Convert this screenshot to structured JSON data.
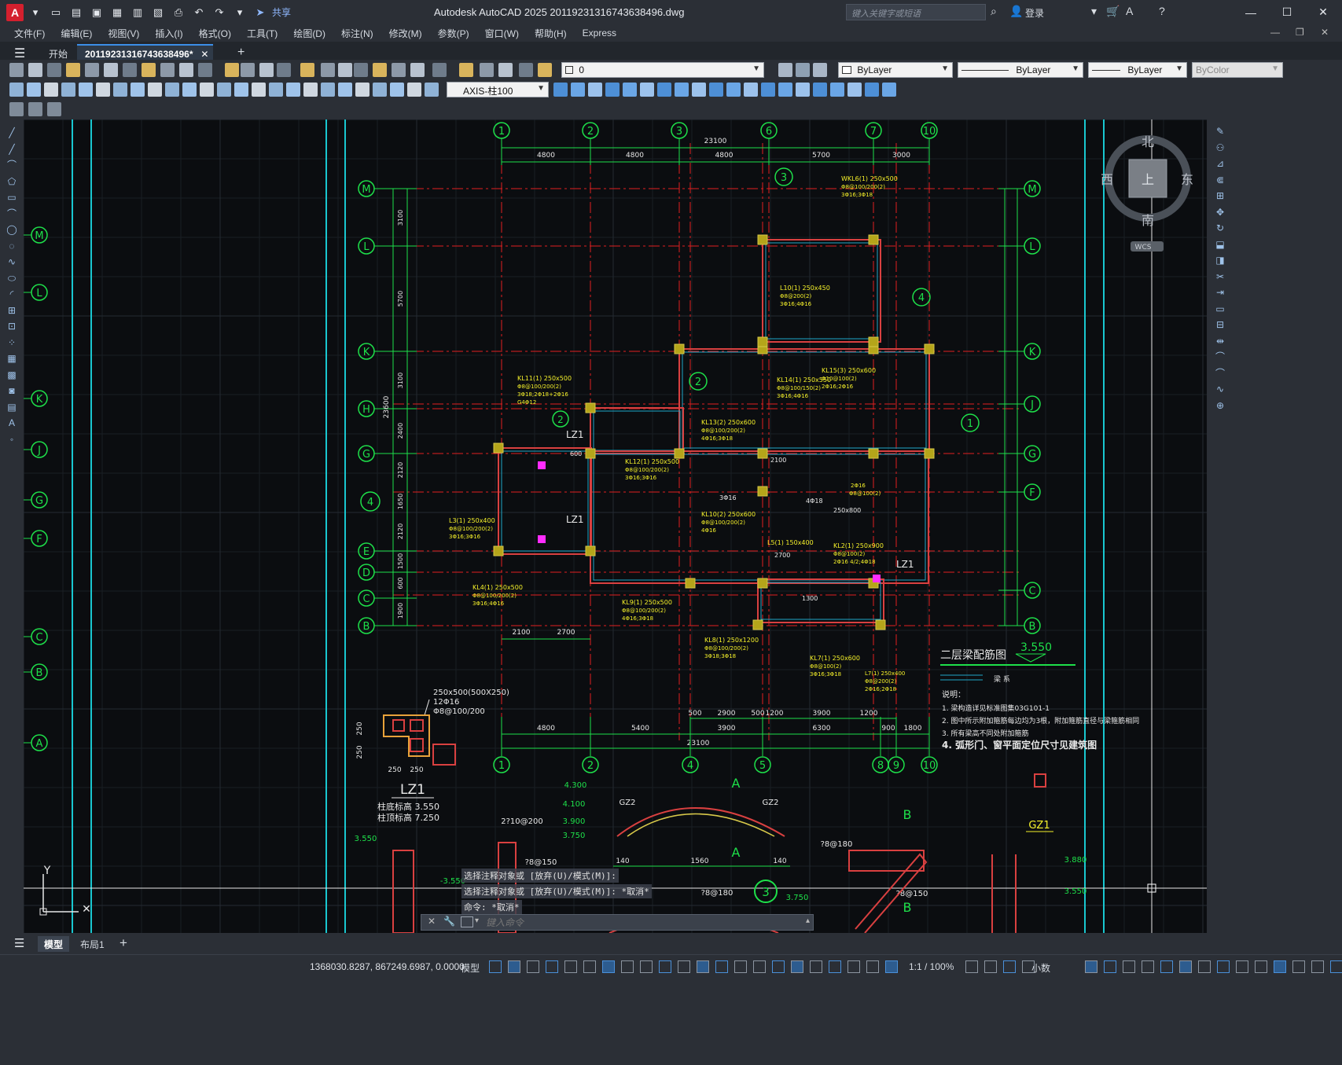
{
  "app": {
    "logo": "A",
    "title": "Autodesk AutoCAD 2025    20119231316743638496.dwg",
    "share": "共享",
    "search_placeholder": "键入关键字或短语",
    "login": "登录"
  },
  "menu": [
    "文件(F)",
    "编辑(E)",
    "视图(V)",
    "插入(I)",
    "格式(O)",
    "工具(T)",
    "绘图(D)",
    "标注(N)",
    "修改(M)",
    "参数(P)",
    "窗口(W)",
    "帮助(H)",
    "Express"
  ],
  "tabs": {
    "start": "开始",
    "document": "20119231316743638496*"
  },
  "props": {
    "layer": "0",
    "color": "ByLayer",
    "linetype": "ByLayer",
    "lineweight": "ByLayer",
    "plotstyle": "ByColor",
    "dimstyle": "AXIS-柱100"
  },
  "viewcube": {
    "north": "北",
    "south": "南",
    "east": "东",
    "west": "西",
    "top": "上",
    "wcs": "WCS"
  },
  "drawing": {
    "top_axes": [
      "1",
      "2",
      "3",
      "6",
      "7",
      "10"
    ],
    "top_total": "23100",
    "top_spans": [
      "4800",
      "4800",
      "4800",
      "5700",
      "3000"
    ],
    "bottom_axes": [
      "1",
      "2",
      "4",
      "5",
      "8",
      "9",
      "10"
    ],
    "bottom_total": "23100",
    "bottom_spans": [
      "4800",
      "5400",
      "3900",
      "6300",
      "900",
      "1800"
    ],
    "left_rows": [
      "M",
      "L",
      "K",
      "H",
      "G",
      "E",
      "D",
      "C",
      "B"
    ],
    "right_rows": [
      "M",
      "L",
      "K",
      "J",
      "G",
      "F",
      "C",
      "B"
    ],
    "far_left_rows": [
      "M",
      "L",
      "K",
      "J",
      "G",
      "F",
      "C",
      "B",
      "A"
    ],
    "left_dims": [
      "3100",
      "5700",
      "3100",
      "2400",
      "2120",
      "1650",
      "2120",
      "1500",
      "600",
      "1900"
    ],
    "left_total": "23600",
    "title": "二层梁配筋图",
    "title_level": "3.550",
    "legend": "梁 系",
    "notes_header": "说明：",
    "notes": [
      "1. 梁构造详见标准图集03G101-1",
      "2. 图中所示附加箍筋每边均为3根，附加箍筋直径与梁箍筋相同",
      "3. 所有梁高不同处附加箍筋",
      "4. 弧形门、窗平面定位尺寸见建筑图"
    ],
    "column_label": "LZ1",
    "column_spec": "250x500(500X250)",
    "column_rebar": "12Φ16",
    "column_stirrup": "Φ8@100/200",
    "column_base": "柱底标高 3.550",
    "column_top": "柱顶标高 7.250",
    "gz1_label": "GZ1",
    "section_label": "3",
    "beam_labels": [
      "KL11(1) 250x500",
      "KL12(1) 250x500",
      "KL13(2) 250x600",
      "KL14(1) 250x550",
      "KL15(3) 250x600",
      "KL10(2) 250x600",
      "KL8(1) 250x1200",
      "KL7(1) 250x600",
      "KL9(1) 250x500",
      "KL4(1) 250x500",
      "L10(1) 250x450",
      "L3(1) 250x400",
      "L5(1) 150x400",
      "KL2(1) 250x900",
      "WKL6(1) 250x500"
    ]
  },
  "command": {
    "history": [
      "选择注释对象或 [放弃(U)/模式(M)]:",
      "选择注释对象或 [放弃(U)/模式(M)]: *取消*",
      "命令: *取消*"
    ],
    "placeholder": "键入命令"
  },
  "layout_tabs": [
    "模型",
    "布局1"
  ],
  "status": {
    "coords": "1368030.8287, 867249.6987, 0.0000",
    "mode": "模型",
    "scale": "1:1 / 100%",
    "units": "小数"
  }
}
